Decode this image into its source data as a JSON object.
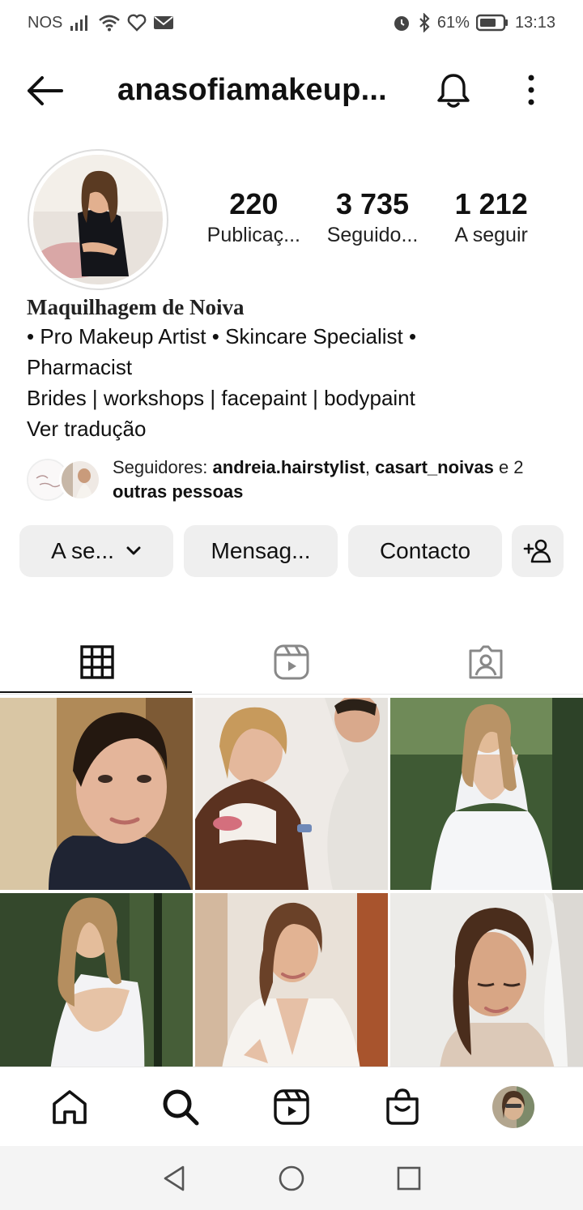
{
  "status_bar": {
    "carrier": "NOS",
    "battery": "61%",
    "time": "13:13"
  },
  "header": {
    "username": "anasofiamakeup..."
  },
  "profile": {
    "stats": [
      {
        "value": "220",
        "label": "Publicaç..."
      },
      {
        "value": "3 735",
        "label": "Seguido..."
      },
      {
        "value": "1 212",
        "label": "A seguir"
      }
    ],
    "bio": {
      "name": "Maquilhagem de Noiva",
      "line1": "• Pro Makeup Artist • Skincare Specialist •",
      "line2": "Pharmacist",
      "line3": "Brides | workshops | facepaint | bodypaint",
      "translate": "Ver tradução"
    },
    "followers": {
      "prefix": "Seguidores: ",
      "user1": "andreia.hairstylist",
      "separator": ", ",
      "user2": "casart_noivas",
      "connector": " e 2",
      "suffix": "outras pessoas"
    }
  },
  "actions": {
    "follow_label": "A se...",
    "message_label": "Mensag...",
    "contact_label": "Contacto"
  },
  "icons": {
    "back": "arrow-left-icon",
    "notifications": "bell-icon",
    "more": "more-vertical-icon",
    "grid_tab": "grid-icon",
    "reels_tab": "reels-icon",
    "tagged_tab": "tagged-icon",
    "home": "home-icon",
    "search": "search-icon",
    "reels": "reels-icon",
    "shop": "shop-icon"
  }
}
